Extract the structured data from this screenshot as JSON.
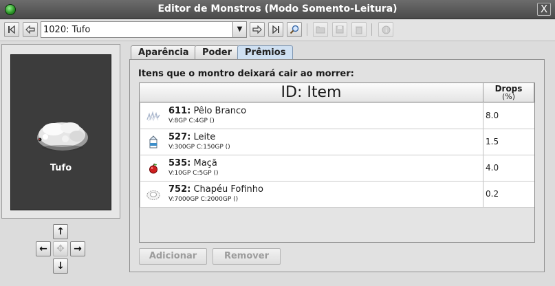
{
  "window": {
    "title": "Editor de Monstros (Modo Somento-Leitura)",
    "close_glyph": "X"
  },
  "toolbar": {
    "selector_value": "1020: Tufo"
  },
  "preview": {
    "monster_name": "Tufo"
  },
  "tabs": [
    {
      "label": "Aparência"
    },
    {
      "label": "Poder"
    },
    {
      "label": "Prêmios",
      "active": true
    }
  ],
  "drops_panel": {
    "caption": "Itens que o montro deixará cair ao morrer:",
    "columns": {
      "item": "ID: Item",
      "drops": "Drops",
      "drops_unit": "(%)"
    },
    "rows": [
      {
        "id": "611:",
        "name": "Pêlo Branco",
        "details": "V:8GP C:4GP ()",
        "drops": "8.0",
        "icon": "white-fur-icon"
      },
      {
        "id": "527:",
        "name": "Leite",
        "details": "V:300GP C:150GP ()",
        "drops": "1.5",
        "icon": "milk-carton-icon"
      },
      {
        "id": "535:",
        "name": "Maçã",
        "details": "V:10GP C:5GP ()",
        "drops": "4.0",
        "icon": "apple-icon"
      },
      {
        "id": "752:",
        "name": "Chapéu Fofinho",
        "details": "V:7000GP C:2000GP ()",
        "drops": "0.2",
        "icon": "fluffy-hat-icon"
      }
    ],
    "buttons": {
      "add": "Adicionar",
      "remove": "Remover"
    }
  },
  "colors": {
    "title_bar": "#4a4a4a",
    "active_tab": "#cfe0f2",
    "preview_bg": "#3c3c3c"
  }
}
